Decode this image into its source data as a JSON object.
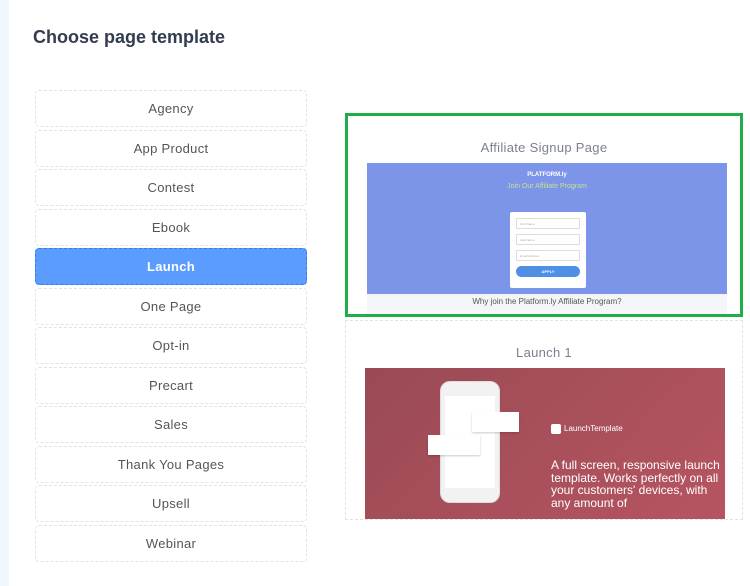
{
  "page": {
    "title": "Choose page template"
  },
  "categories": [
    {
      "label": "Agency",
      "active": false
    },
    {
      "label": "App Product",
      "active": false
    },
    {
      "label": "Contest",
      "active": false
    },
    {
      "label": "Ebook",
      "active": false
    },
    {
      "label": "Launch",
      "active": true
    },
    {
      "label": "One Page",
      "active": false
    },
    {
      "label": "Opt-in",
      "active": false
    },
    {
      "label": "Precart",
      "active": false
    },
    {
      "label": "Sales",
      "active": false
    },
    {
      "label": "Thank You Pages",
      "active": false
    },
    {
      "label": "Upsell",
      "active": false
    },
    {
      "label": "Webinar",
      "active": false
    }
  ],
  "templates": [
    {
      "title": "Affiliate Signup Page",
      "selected": true,
      "preview": {
        "logo": "PLATFORM.ly",
        "heading": "Join Our Affiliate Program",
        "fields": [
          "First Name",
          "Last Name",
          "Email Address"
        ],
        "button": "APPLY",
        "section": "Why join the Platform.ly Affiliate Program?"
      }
    },
    {
      "title": "Launch 1",
      "selected": false,
      "preview": {
        "logo": "LaunchTemplate",
        "text": "A full screen, responsive launch template. Works perfectly on all your customers' devices, with any amount of"
      }
    }
  ],
  "colors": {
    "accent": "#5b9cff",
    "selected_border": "#1fad48",
    "affiliate_bg": "#7d95e9",
    "launch_bg": "#b05461"
  }
}
